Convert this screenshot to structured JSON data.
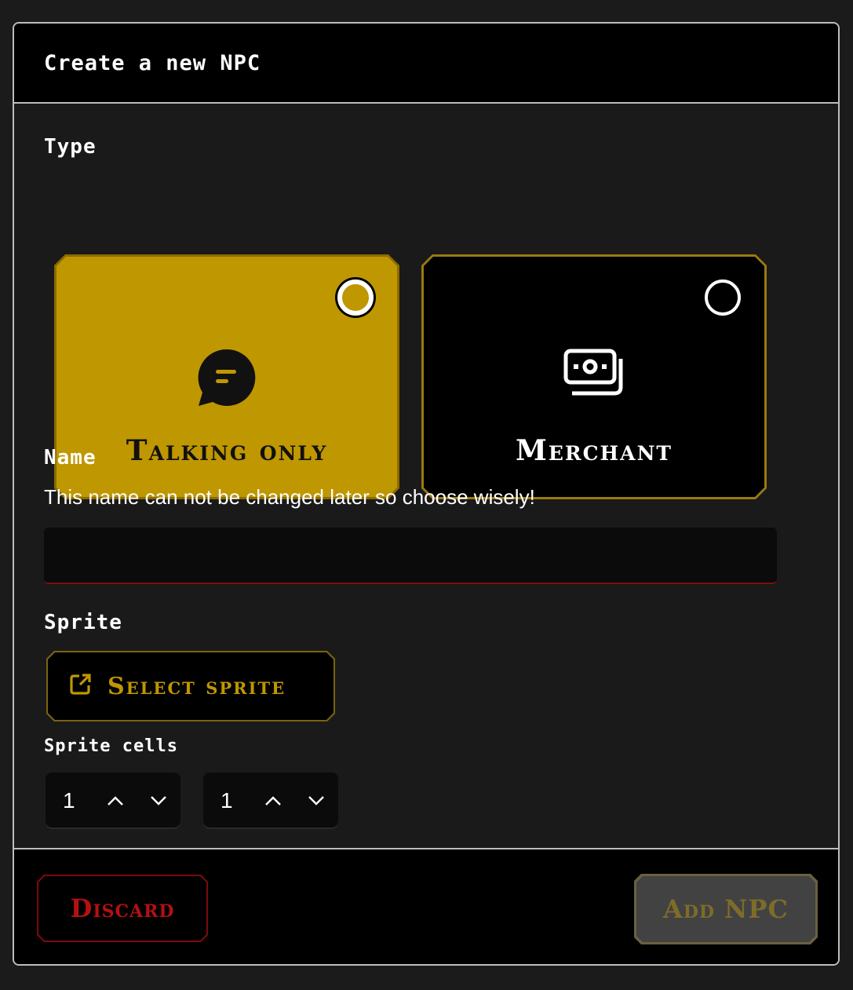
{
  "dialog": {
    "title": "Create a new NPC"
  },
  "type_section": {
    "label": "Type",
    "options": [
      {
        "label": "Talking only",
        "icon": "chat-bubble-icon",
        "selected": true
      },
      {
        "label": "Merchant",
        "icon": "money-icon",
        "selected": false
      }
    ]
  },
  "name_section": {
    "label": "Name",
    "description": "This name can not be changed later so choose wisely!",
    "value": "",
    "placeholder": ""
  },
  "sprite_section": {
    "label": "Sprite",
    "select_button": "Select sprite",
    "button_icon": "external-link-icon"
  },
  "sprite_cells": {
    "label": "Sprite cells",
    "values": [
      "1",
      "1"
    ]
  },
  "footer": {
    "discard_label": "Discard",
    "add_label": "Add NPC"
  },
  "colors": {
    "accent": "#bf9700",
    "danger": "#b51010",
    "background": "#1a1a1a"
  }
}
